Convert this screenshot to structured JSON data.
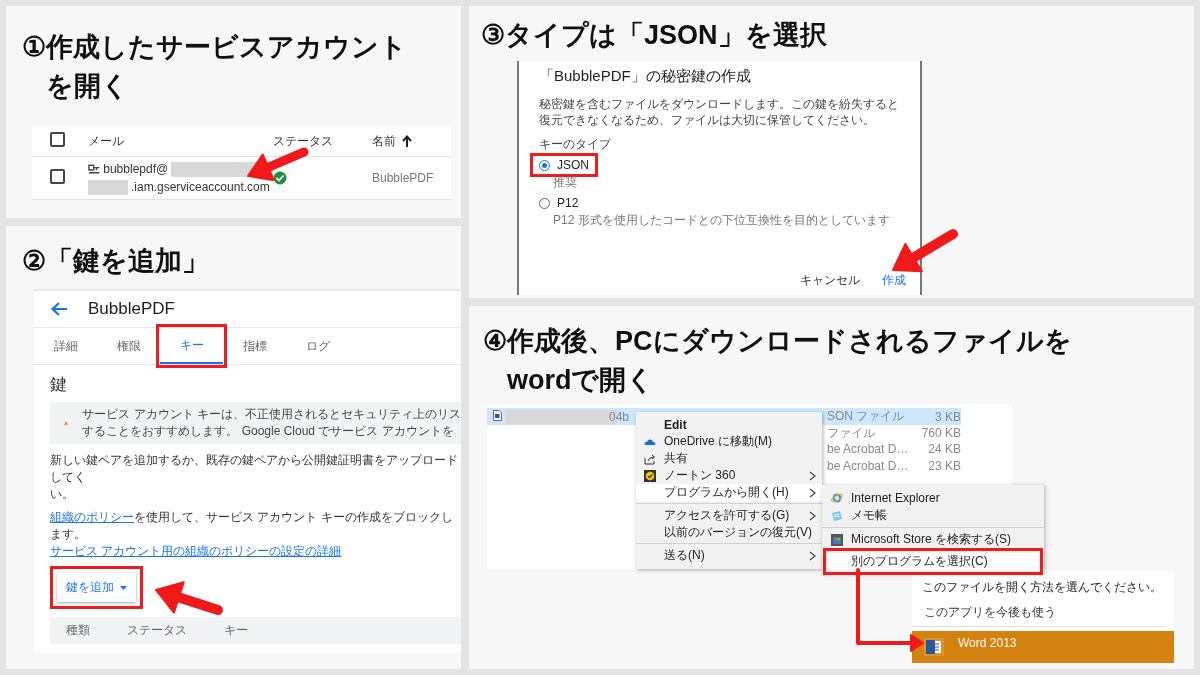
{
  "steps": [
    {
      "kind": "accounts",
      "number": "①",
      "title_lines": [
        "作成したサービスアカウント",
        "を開く"
      ],
      "table": {
        "header_checked": false,
        "columns": [
          {
            "label": "メール",
            "sorted": false
          },
          {
            "label": "ステータス",
            "sorted": false
          },
          {
            "label": "名前",
            "sorted": true
          }
        ],
        "rows": [
          {
            "checked": false,
            "email_start": "bubblepdf@",
            "email_end": ".iam.gserviceaccount.com",
            "name": "BubblePDF"
          }
        ]
      }
    },
    {
      "kind": "keys",
      "number": "②",
      "title_lines": [
        "「鍵を追加」"
      ],
      "page_title": "BubblePDF",
      "tabs": [
        {
          "label": "詳細",
          "selected": false,
          "highlighted": false
        },
        {
          "label": "権限",
          "selected": false,
          "highlighted": false
        },
        {
          "label": "キー",
          "selected": true,
          "highlighted": true
        },
        {
          "label": "指標",
          "selected": false,
          "highlighted": false
        },
        {
          "label": "ログ",
          "selected": false,
          "highlighted": false
        }
      ],
      "heading": "鍵",
      "warning_lines": [
        "サービス アカウント キーは、不正使用されるとセキュリティ上のリス",
        "することをおすすめします。 Google Cloud でサービス アカウントを"
      ],
      "intro_lines": [
        "新しい鍵ペアを追加するか、既存の鍵ペアから公開鍵証明書をアップロードしてく",
        "い。"
      ],
      "policy": {
        "link": "組織のポリシー",
        "text": "を使用して、サービス アカウント キーの作成をブロックします。",
        "details_link": "サービス アカウント用の組織のポリシーの設定の詳細"
      },
      "add_button": {
        "label": "鍵を追加",
        "highlighted": true
      },
      "columns": [
        "種類",
        "ステータス",
        "キー"
      ]
    },
    {
      "kind": "dialog",
      "number": "③",
      "title_lines": [
        "タイプは「JSON」を選択"
      ],
      "dialog": {
        "title": "「BubblePDF」の秘密鍵の作成",
        "description": "秘密鍵を含むファイルをダウンロードします。この鍵を紛失すると復元できなくなるため、ファイルは大切に保管してください。",
        "group_label": "キーのタイプ",
        "options": [
          {
            "label": "JSON",
            "hint": "推奨",
            "selected": true,
            "highlighted": true
          },
          {
            "label": "P12",
            "hint": "P12 形式を使用したコードとの下位互換性を目的としています",
            "selected": false,
            "highlighted": false
          }
        ],
        "buttons": [
          {
            "label": "キャンセル",
            "kind": "text"
          },
          {
            "label": "作成",
            "kind": "primary"
          }
        ]
      }
    },
    {
      "kind": "explorer",
      "number": "④",
      "title_lines": [
        "作成後、PCにダウンロードされるファイルを",
        "wordで開く"
      ],
      "files": [
        {
          "name_tail": "04b",
          "type": "SON ファイル",
          "size": "3 KB",
          "selected": true
        },
        {
          "type": "ファイル",
          "size": "760 KB",
          "selected": false
        },
        {
          "type": "be Acrobat D…",
          "size": "24 KB",
          "selected": false
        },
        {
          "type": "be Acrobat D…",
          "size": "23 KB",
          "selected": false
        }
      ],
      "menu": [
        [
          {
            "label": "Edit",
            "kind": "bold",
            "submenu": false,
            "hover": false
          },
          {
            "label": "OneDrive に移動(M)",
            "kind": "cloud",
            "submenu": false,
            "hover": false
          },
          {
            "label": "共有",
            "kind": "share",
            "submenu": false,
            "hover": false
          },
          {
            "label": "ノートン 360",
            "kind": "badge",
            "submenu": true,
            "hover": false
          },
          {
            "label": "プログラムから開く(H)",
            "kind": "plain",
            "submenu": true,
            "hover": true
          }
        ],
        [
          {
            "label": "アクセスを許可する(G)",
            "kind": "plain",
            "submenu": true,
            "hover": false
          },
          {
            "label": "以前のバージョンの復元(V)",
            "kind": "plain",
            "submenu": false,
            "hover": false
          }
        ],
        [
          {
            "label": "送る(N)",
            "kind": "plain",
            "submenu": true,
            "hover": false
          }
        ]
      ],
      "submenu": [
        [
          {
            "label": "Internet Explorer",
            "kind": "browser",
            "highlighted": false
          },
          {
            "label": "メモ帳",
            "kind": "notepad",
            "highlighted": false
          }
        ],
        [
          {
            "label": "Microsoft Store を検索する(S)",
            "kind": "store",
            "highlighted": false
          },
          {
            "label": "別のプログラムを選択(C)",
            "kind": "plain",
            "highlighted": true
          }
        ]
      ],
      "open_with": {
        "prompt": "このファイルを開く方法を選んでください。",
        "remember_label": "このアプリを今後も使う",
        "apps": [
          {
            "name": "Word 2013",
            "selected": true
          }
        ]
      }
    }
  ]
}
